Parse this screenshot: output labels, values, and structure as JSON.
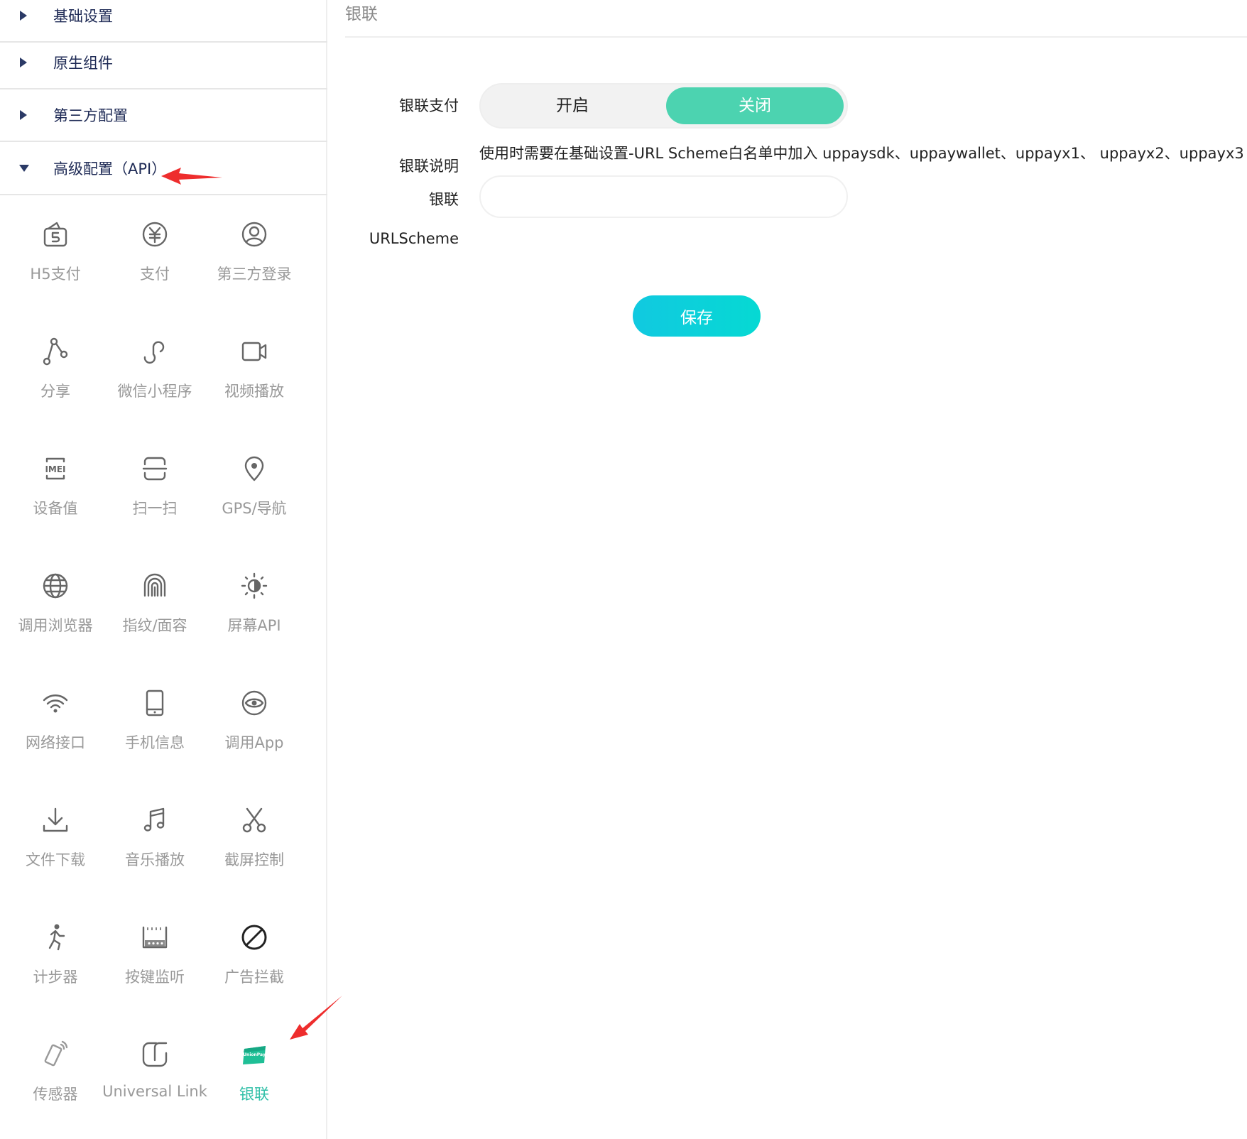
{
  "sidebar": {
    "menus": [
      {
        "label": "基础设置",
        "state": "collapsed"
      },
      {
        "label": "原生组件",
        "state": "collapsed"
      },
      {
        "label": "第三方配置",
        "state": "collapsed"
      },
      {
        "label": "高级配置（API）",
        "state": "expanded"
      }
    ],
    "items": [
      {
        "label": "H5支付",
        "icon": "h5-pay-icon"
      },
      {
        "label": "支付",
        "icon": "yen-circle-icon"
      },
      {
        "label": "第三方登录",
        "icon": "user-circle-icon"
      },
      {
        "label": "分享",
        "icon": "share-icon"
      },
      {
        "label": "微信小程序",
        "icon": "mini-program-icon"
      },
      {
        "label": "视频播放",
        "icon": "video-camera-icon"
      },
      {
        "label": "设备值",
        "icon": "imei-icon"
      },
      {
        "label": "扫一扫",
        "icon": "scan-icon"
      },
      {
        "label": "GPS/导航",
        "icon": "location-pin-icon"
      },
      {
        "label": "调用浏览器",
        "icon": "globe-icon"
      },
      {
        "label": "指纹/面容",
        "icon": "fingerprint-icon"
      },
      {
        "label": "屏幕API",
        "icon": "brightness-icon"
      },
      {
        "label": "网络接口",
        "icon": "wifi-icon"
      },
      {
        "label": "手机信息",
        "icon": "phone-icon"
      },
      {
        "label": "调用App",
        "icon": "eye-icon"
      },
      {
        "label": "文件下载",
        "icon": "download-icon"
      },
      {
        "label": "音乐播放",
        "icon": "music-note-icon"
      },
      {
        "label": "截屏控制",
        "icon": "scissors-icon"
      },
      {
        "label": "计步器",
        "icon": "running-person-icon"
      },
      {
        "label": "按键监听",
        "icon": "keyboard-icon"
      },
      {
        "label": "广告拦截",
        "icon": "block-icon"
      },
      {
        "label": "传感器",
        "icon": "phone-shake-icon"
      },
      {
        "label": "Universal Link",
        "icon": "universal-link-icon"
      },
      {
        "label": "银联",
        "icon": "unionpay-icon",
        "active": true
      }
    ],
    "accent_color": "#2fbfa7"
  },
  "main": {
    "title": "银联",
    "form": {
      "pay_label": "银联支付",
      "toggle_on": "开启",
      "toggle_off": "关闭",
      "toggle_selected": "关闭",
      "desc_label": "银联说明",
      "desc_text": "使用时需要在基础设置-URL Scheme白名单中加入 uppaysdk、uppaywallet、uppayx1、 uppayx2、uppayx3",
      "scheme_label_1": "银联",
      "scheme_label_2": "URLScheme",
      "scheme_value": "",
      "scheme_placeholder": ""
    },
    "save_label": "保存",
    "toggle_color": "#4cd3b0",
    "button_color": "#11c9e0"
  }
}
